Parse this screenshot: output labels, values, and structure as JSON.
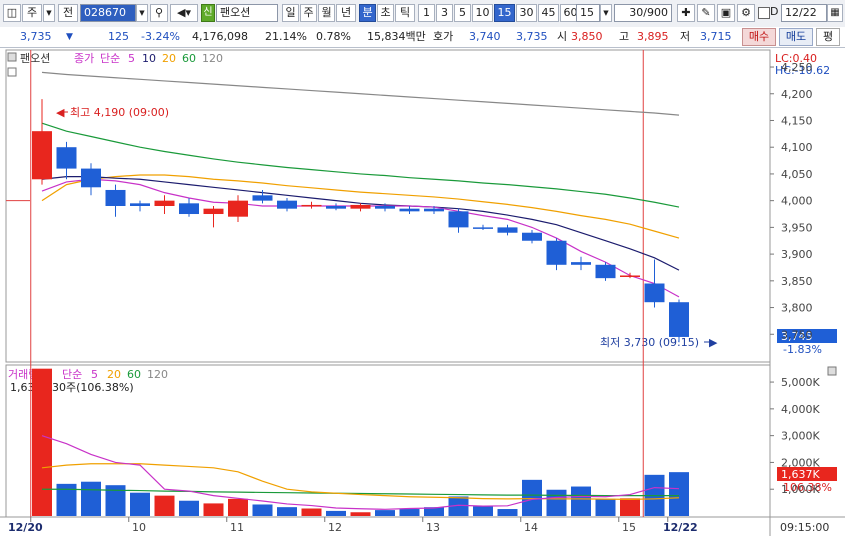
{
  "toolbar": {
    "code_prefix": "주",
    "code_type": "전",
    "stock_code": "028670",
    "stock_badge": "신",
    "stock_name": "팬오션",
    "period_buttons": [
      "일",
      "주",
      "월",
      "년",
      "분",
      "초",
      "틱"
    ],
    "period_selected": "분",
    "interval_buttons": [
      "1",
      "3",
      "5",
      "10",
      "15",
      "30",
      "45",
      "60"
    ],
    "interval_selected": "15",
    "interval_value": "15",
    "count": "30/900",
    "d_label": "D",
    "date": "12/22"
  },
  "quote": {
    "price": "3,735",
    "change": "125",
    "change_pct": "-3.24%",
    "volume": "4,176,098",
    "turnover_pct": "21.14%",
    "ratio": "0.78%",
    "amount": "15,834백만",
    "ask_label": "호가",
    "ask": "3,740",
    "bid": "3,735",
    "open_label": "시",
    "open": "3,850",
    "high_label": "고",
    "high": "3,895",
    "low_label": "저",
    "low": "3,715",
    "buy_button": "매수",
    "sell_button": "매도",
    "eval_button": "평"
  },
  "price_panel": {
    "legend_name": "팬오션",
    "legend_close": "종가",
    "legend_type": "단순",
    "legend_periods": [
      "5",
      "10",
      "20",
      "60",
      "120"
    ],
    "lc": "LC:0.40",
    "hc": "HC:-10.62",
    "high_note": "최고 4,190 (09:00)",
    "low_note": "최저 3,730 (09:15)",
    "current_price": "3,745",
    "current_pct": "-1.83%"
  },
  "volume_panel": {
    "legend_name": "거래량",
    "legend_type": "단순",
    "legend_periods": [
      "5",
      "20",
      "60",
      "120"
    ],
    "first_volume": "1,637,830주(106.38%)",
    "current_volume": "1,637K",
    "current_pct": "106.38%"
  },
  "x_labels": [
    "12/20",
    "10",
    "11",
    "12",
    "13",
    "14",
    "15",
    "12/22"
  ],
  "time_label": "09:15:00",
  "colors": {
    "up": "#e8261e",
    "down": "#1f5fd6",
    "ma5": "#c832c8",
    "ma10": "#1c1c6e",
    "ma20": "#f0a000",
    "ma60": "#1a9a3a",
    "ma120": "#888888"
  },
  "chart_data": {
    "type": "candlestick",
    "price_ticks": [
      4250,
      4200,
      4150,
      4100,
      4050,
      4000,
      3950,
      3900,
      3850,
      3800,
      3750
    ],
    "volume_ticks": [
      "5,000K",
      "4,000K",
      "3,000K",
      "2,000K",
      "1,000K"
    ],
    "volume_tick_values": [
      5000,
      4000,
      3000,
      2000,
      1000
    ],
    "ylim_price": [
      3700,
      4280
    ],
    "ylim_volume": [
      0,
      5600
    ],
    "candles": [
      {
        "o": 4040,
        "h": 4190,
        "l": 4030,
        "c": 4130
      },
      {
        "o": 4100,
        "h": 4110,
        "l": 4040,
        "c": 4060
      },
      {
        "o": 4060,
        "h": 4070,
        "l": 4010,
        "c": 4025
      },
      {
        "o": 4020,
        "h": 4030,
        "l": 3970,
        "c": 3990
      },
      {
        "o": 3995,
        "h": 4000,
        "l": 3980,
        "c": 3990
      },
      {
        "o": 3990,
        "h": 4010,
        "l": 3975,
        "c": 4000
      },
      {
        "o": 3995,
        "h": 4005,
        "l": 3970,
        "c": 3975
      },
      {
        "o": 3975,
        "h": 3990,
        "l": 3950,
        "c": 3985
      },
      {
        "o": 3970,
        "h": 4010,
        "l": 3960,
        "c": 4000
      },
      {
        "o": 4010,
        "h": 4020,
        "l": 3995,
        "c": 4000
      },
      {
        "o": 4000,
        "h": 4005,
        "l": 3980,
        "c": 3985
      },
      {
        "o": 3990,
        "h": 3998,
        "l": 3985,
        "c": 3992
      },
      {
        "o": 3990,
        "h": 3995,
        "l": 3982,
        "c": 3985
      },
      {
        "o": 3985,
        "h": 3995,
        "l": 3980,
        "c": 3992
      },
      {
        "o": 3990,
        "h": 3995,
        "l": 3980,
        "c": 3985
      },
      {
        "o": 3985,
        "h": 3990,
        "l": 3975,
        "c": 3980
      },
      {
        "o": 3985,
        "h": 3990,
        "l": 3975,
        "c": 3980
      },
      {
        "o": 3980,
        "h": 3985,
        "l": 3940,
        "c": 3950
      },
      {
        "o": 3950,
        "h": 3955,
        "l": 3945,
        "c": 3948
      },
      {
        "o": 3950,
        "h": 3955,
        "l": 3935,
        "c": 3940
      },
      {
        "o": 3940,
        "h": 3945,
        "l": 3920,
        "c": 3925
      },
      {
        "o": 3925,
        "h": 3930,
        "l": 3870,
        "c": 3880
      },
      {
        "o": 3885,
        "h": 3895,
        "l": 3870,
        "c": 3880
      },
      {
        "o": 3880,
        "h": 3885,
        "l": 3850,
        "c": 3855
      },
      {
        "o": 3860,
        "h": 3865,
        "l": 3855,
        "c": 3860
      },
      {
        "o": 3845,
        "h": 3890,
        "l": 3800,
        "c": 3810
      },
      {
        "o": 3810,
        "h": 3815,
        "l": 3735,
        "c": 3745
      }
    ],
    "volumes": [
      5500,
      1200,
      1280,
      1150,
      870,
      760,
      570,
      470,
      640,
      430,
      330,
      280,
      190,
      140,
      220,
      260,
      330,
      730,
      360,
      260,
      1350,
      980,
      1100,
      640,
      660,
      1537,
      1637
    ],
    "ma5": [
      4018,
      4035,
      4040,
      4037,
      4030,
      4015,
      4005,
      3997,
      3995,
      3990,
      3990,
      3990,
      3990,
      3990,
      3990,
      3990,
      3988,
      3980,
      3972,
      3965,
      3950,
      3930,
      3905,
      3885,
      3860,
      3845,
      3820
    ],
    "ma10": [
      4040,
      4045,
      4045,
      4042,
      4040,
      4035,
      4030,
      4025,
      4020,
      4015,
      4010,
      4005,
      4000,
      3995,
      3992,
      3990,
      3988,
      3985,
      3980,
      3973,
      3965,
      3955,
      3940,
      3925,
      3910,
      3893,
      3870
    ],
    "ma20": [
      4000,
      4030,
      4040,
      4045,
      4048,
      4048,
      4045,
      4040,
      4037,
      4033,
      4028,
      4024,
      4020,
      4016,
      4013,
      4010,
      4007,
      4003,
      3998,
      3993,
      3987,
      3980,
      3972,
      3965,
      3956,
      3943,
      3930
    ],
    "ma60": [
      4145,
      4130,
      4120,
      4110,
      4100,
      4092,
      4085,
      4078,
      4072,
      4067,
      4062,
      4058,
      4054,
      4050,
      4047,
      4043,
      4040,
      4037,
      4033,
      4030,
      4026,
      4022,
      4017,
      4012,
      4005,
      3997,
      3988
    ],
    "ma120": [
      4240,
      4236,
      4233,
      4230,
      4227,
      4224,
      4221,
      4218,
      4215,
      4212,
      4209,
      4206,
      4203,
      4200,
      4197,
      4194,
      4191,
      4188,
      4185,
      4182,
      4179,
      4176,
      4173,
      4170,
      4167,
      4164,
      4160
    ],
    "vol_ma5": [
      3000,
      2700,
      2300,
      2000,
      1900,
      1000,
      930,
      760,
      660,
      560,
      450,
      390,
      300,
      270,
      250,
      280,
      300,
      400,
      370,
      380,
      620,
      690,
      730,
      720,
      800,
      1060,
      1020
    ],
    "vol_ma20": [
      1800,
      1900,
      1950,
      1950,
      1950,
      1900,
      1850,
      1800,
      1650,
      1300,
      1000,
      900,
      850,
      800,
      760,
      720,
      700,
      680,
      650,
      640,
      650,
      640,
      640,
      630,
      620,
      640,
      680
    ],
    "vol_ma60": [
      1000,
      1000,
      980,
      960,
      950,
      930,
      920,
      900,
      890,
      880,
      870,
      860,
      850,
      840,
      830,
      820,
      810,
      800,
      790,
      780,
      780,
      770,
      770,
      760,
      760,
      760,
      760
    ]
  }
}
